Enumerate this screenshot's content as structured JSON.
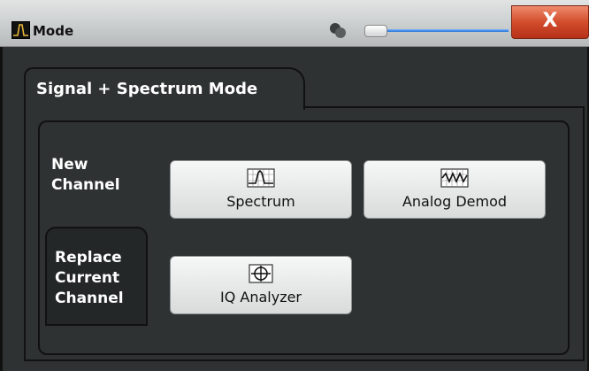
{
  "window": {
    "title": "Mode",
    "close_label": "X"
  },
  "tab": {
    "label": "Signal + Spectrum Mode"
  },
  "sections": {
    "new_channel_line1": "New",
    "new_channel_line2": "Channel",
    "replace_line1": "Replace",
    "replace_line2": "Current",
    "replace_line3": "Channel"
  },
  "buttons": [
    {
      "label": "Spectrum",
      "icon": "spectrum-icon"
    },
    {
      "label": "Analog Demod",
      "icon": "analog-demod-icon"
    },
    {
      "label": "IQ Analyzer",
      "icon": "iq-analyzer-icon"
    }
  ],
  "colors": {
    "background": "#2e3232",
    "close_button": "#d24d2c",
    "slider_track": "#1f6fd6",
    "button_face": "#f0f1f1"
  }
}
